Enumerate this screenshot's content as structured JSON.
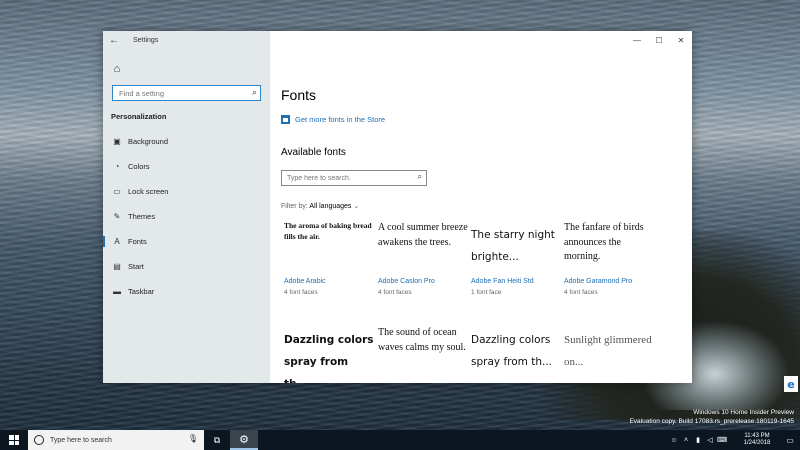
{
  "window": {
    "title": "Settings",
    "controls": [
      "—",
      "☐",
      "✕"
    ]
  },
  "sidebar": {
    "search_placeholder": "Find a setting",
    "section_label": "Personalization",
    "items": [
      {
        "label": "Background",
        "icon": "picture-icon"
      },
      {
        "label": "Colors",
        "icon": "palette-icon"
      },
      {
        "label": "Lock screen",
        "icon": "monitor-icon"
      },
      {
        "label": "Themes",
        "icon": "brush-icon"
      },
      {
        "label": "Fonts",
        "icon": "font-icon",
        "active": true
      },
      {
        "label": "Start",
        "icon": "start-icon"
      },
      {
        "label": "Taskbar",
        "icon": "taskbar-icon"
      }
    ]
  },
  "main": {
    "title": "Fonts",
    "store_link": "Get more fonts in the Store",
    "available_heading": "Available fonts",
    "search_placeholder": "Type here to search.",
    "filter_label": "Filter by:",
    "filter_value": "All languages",
    "fonts": [
      {
        "sample": "The aroma of baking bread fills the air.",
        "name": "Adobe Arabic",
        "faces": "4 font faces"
      },
      {
        "sample": "A cool summer breeze awakens the trees.",
        "name": "Adobe Caslon Pro",
        "faces": "4 font faces"
      },
      {
        "sample": "The starry night brighte...",
        "name": "Adobe Fan Heiti Std",
        "faces": "1 font face"
      },
      {
        "sample": "The fanfare of birds announces the morning.",
        "name": "Adobe Garamond Pro",
        "faces": "4 font faces"
      },
      {
        "sample": "Dazzling colors spray from th...",
        "name": "",
        "faces": ""
      },
      {
        "sample": "The sound of ocean waves calms my soul.",
        "name": "",
        "faces": ""
      },
      {
        "sample": "Dazzling colors spray from th...",
        "name": "",
        "faces": ""
      },
      {
        "sample": "Sunlight glimmered on...",
        "name": "",
        "faces": ""
      }
    ]
  },
  "taskbar": {
    "search_placeholder": "Type here to search",
    "time": "11:43 PM",
    "date": "1/24/2018"
  },
  "watermark": {
    "line1": "Windows 10 Home Insider Preview",
    "line2": "Evaluation copy. Build 17083.rs_prerelease.180119-1645"
  },
  "colors": {
    "accent": "#1f6fb5",
    "sidebar_bg": "#e1e6ea",
    "taskbar_bg": "#0b1620"
  }
}
